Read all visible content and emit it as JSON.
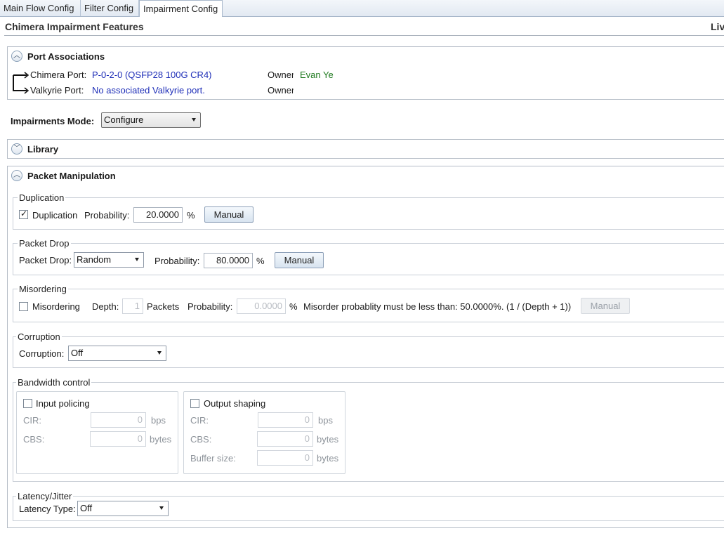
{
  "tabs": [
    "Main Flow Config",
    "Filter Config",
    "Impairment Config"
  ],
  "page_title": "Chimera Impairment Features",
  "header_right": "Liv",
  "port_associations": {
    "title": "Port Associations",
    "chimera_label": "Chimera Port:",
    "chimera_value": "P-0-2-0 (QSFP28 100G CR4)",
    "chimera_owner_label": "Owner",
    "chimera_owner_value": "Evan Ye",
    "valkyrie_label": "Valkyrie Port:",
    "valkyrie_value": "No associated Valkyrie port.",
    "valkyrie_owner_label": "Owner"
  },
  "impairments_mode": {
    "label": "Impairments Mode:",
    "value": "Configure"
  },
  "library": {
    "title": "Library"
  },
  "packet_manipulation": {
    "title": "Packet Manipulation",
    "duplication": {
      "group": "Duplication",
      "checkbox": "Duplication",
      "checked": true,
      "prob_label": "Probability:",
      "prob_value": "20.0000",
      "unit": "%",
      "button": "Manual"
    },
    "packet_drop": {
      "group": "Packet Drop",
      "label": "Packet Drop:",
      "mode": "Random",
      "prob_label": "Probability:",
      "prob_value": "80.0000",
      "unit": "%",
      "button": "Manual"
    },
    "misordering": {
      "group": "Misordering",
      "checkbox": "Misordering",
      "checked": false,
      "depth_label": "Depth:",
      "depth_value": "1",
      "packets": "Packets",
      "prob_label": "Probability:",
      "prob_value": "0.0000",
      "unit": "%",
      "note": "Misorder probablity must be less than: 50.0000%. (1 / (Depth + 1))",
      "button": "Manual"
    },
    "corruption": {
      "group": "Corruption",
      "label": "Corruption:",
      "value": "Off"
    },
    "bandwidth": {
      "group": "Bandwidth control",
      "input_policing": {
        "checkbox": "Input policing",
        "checked": false,
        "cir_label": "CIR:",
        "cir_value": "0",
        "cir_unit": "bps",
        "cbs_label": "CBS:",
        "cbs_value": "0",
        "cbs_unit": "bytes"
      },
      "output_shaping": {
        "checkbox": "Output shaping",
        "checked": false,
        "cir_label": "CIR:",
        "cir_value": "0",
        "cir_unit": "bps",
        "cbs_label": "CBS:",
        "cbs_value": "0",
        "cbs_unit": "bytes",
        "buf_label": "Buffer size:",
        "buf_value": "0",
        "buf_unit": "bytes"
      }
    },
    "latency": {
      "group": "Latency/Jitter",
      "label": "Latency Type:",
      "value": "Off"
    }
  }
}
